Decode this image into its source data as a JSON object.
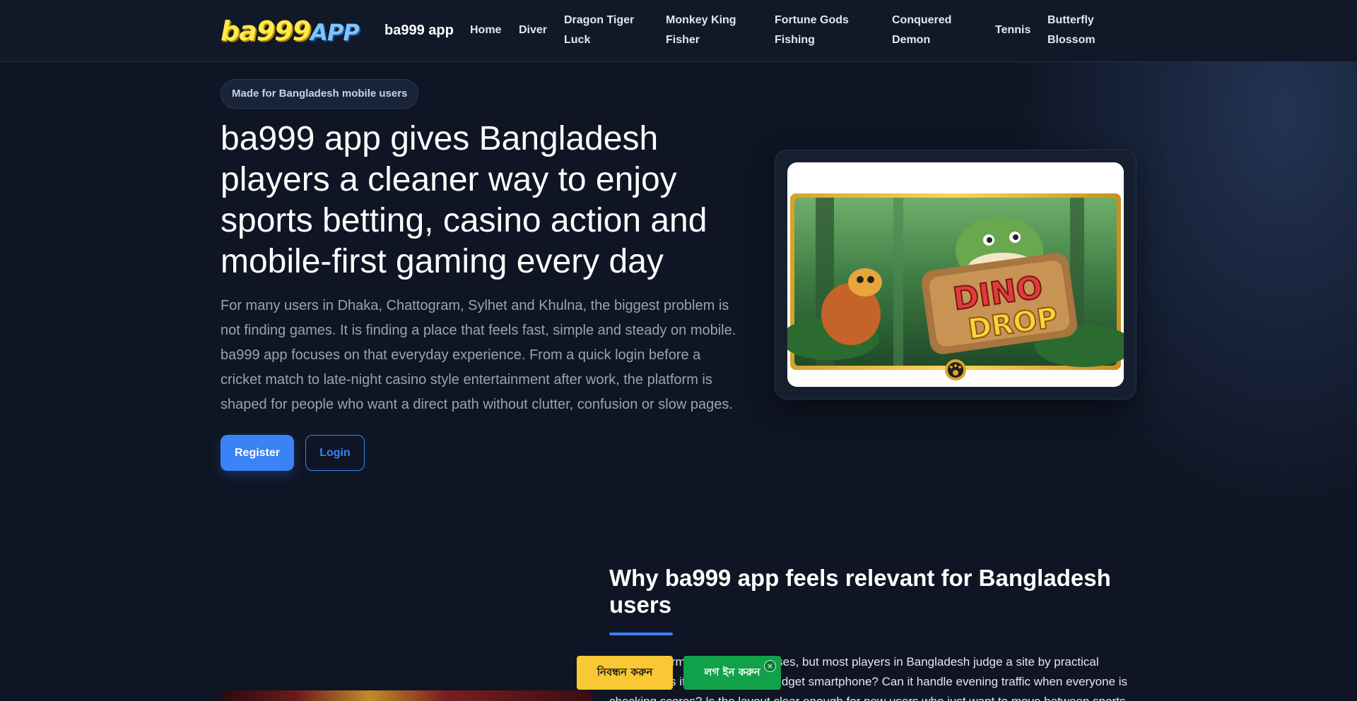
{
  "header": {
    "logo_text_main": "ba999",
    "logo_text_app": "APP",
    "brand_name": "ba999 app",
    "nav": [
      {
        "line1": "Home",
        "line2": ""
      },
      {
        "line1": "Diver",
        "line2": ""
      },
      {
        "line1": "Dragon Tiger",
        "line2": "Luck"
      },
      {
        "line1": "Monkey King",
        "line2": "Fisher"
      },
      {
        "line1": "Fortune Gods",
        "line2": "Fishing"
      },
      {
        "line1": "Conquered",
        "line2": "Demon"
      },
      {
        "line1": "Tennis",
        "line2": ""
      },
      {
        "line1": "Butterfly",
        "line2": "Blossom"
      }
    ]
  },
  "hero": {
    "badge": "Made for Bangladesh mobile users",
    "title": "ba999 app gives Bangladesh players a cleaner way to enjoy sports betting, casino action and mobile-first gaming every day",
    "description": "For many users in Dhaka, Chattogram, Sylhet and Khulna, the biggest problem is not finding games. It is finding a place that feels fast, simple and steady on mobile. ba999 app focuses on that everyday experience. From a quick login before a cricket match to late-night casino style entertainment after work, the platform is shaped for people who want a direct path without clutter, confusion or slow pages.",
    "register_label": "Register",
    "login_label": "Login",
    "image_text_line1": "DINO",
    "image_text_line2": "DROP"
  },
  "why": {
    "title": "Why ba999 app feels relevant for Bangladesh users",
    "text": "Many platforms make big promises, but most players in Bangladesh judge a site by practical things. Does it open fast on a budget smartphone? Can it handle evening traffic when everyone is checking scores? Is the layout clear enough for new users who just want to move between sports and"
  },
  "sticky": {
    "register_label": "নিবন্ধন করুন",
    "login_label": "লগ ইন করুন",
    "close_symbol": "×"
  },
  "colors": {
    "background": "#0f1524",
    "accent": "#3b82f6",
    "sticky_register": "#f9c935",
    "sticky_login": "#11a14a"
  }
}
